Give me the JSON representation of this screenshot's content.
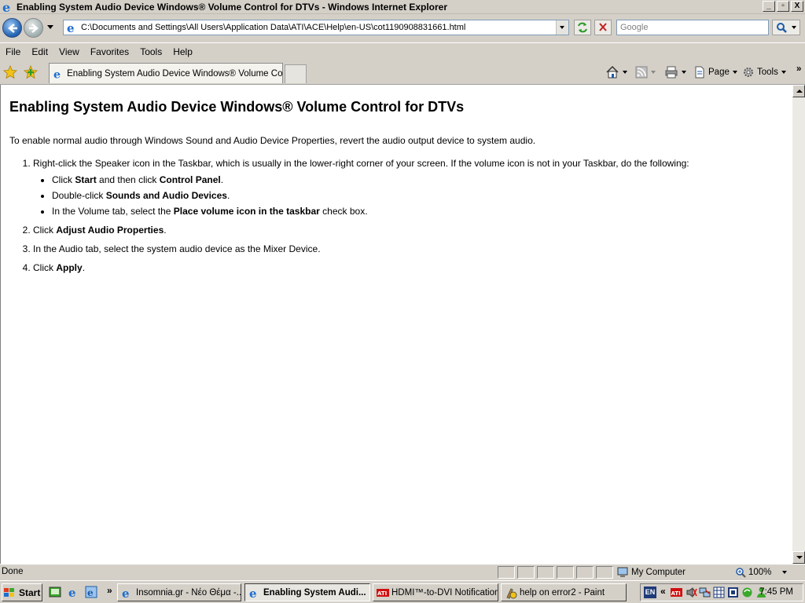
{
  "window": {
    "title": "Enabling System Audio Device Windows® Volume Control for DTVs - Windows Internet Explorer",
    "controls": [
      "_",
      "▫",
      "X"
    ]
  },
  "address_bar": {
    "url": "C:\\Documents and Settings\\All Users\\Application Data\\ATI\\ACE\\Help\\en-US\\cot1190908831661.html"
  },
  "search": {
    "placeholder": "Google"
  },
  "menu": [
    "File",
    "Edit",
    "View",
    "Favorites",
    "Tools",
    "Help"
  ],
  "tabs": [
    {
      "label": "Enabling System Audio Device Windows® Volume Con..."
    }
  ],
  "command_bar": {
    "page_label": "Page",
    "tools_label": "Tools",
    "overflow": "»"
  },
  "document": {
    "heading": "Enabling System Audio Device Windows® Volume Control for DTVs",
    "intro": "To enable normal audio through Windows Sound and Audio Device Properties, revert the audio output device to system audio.",
    "steps": [
      {
        "parts": [
          "Right-click the Speaker icon in the Taskbar, which is usually in the lower-right corner of your screen. If the volume icon is not in your Taskbar, do the following:"
        ],
        "substeps": [
          [
            "Click ",
            "Start",
            " and then click ",
            "Control Panel",
            "."
          ],
          [
            "Double-click ",
            "Sounds and Audio Devices",
            "."
          ],
          [
            "In the Volume tab, select the ",
            "Place volume icon in the taskbar",
            " check box."
          ]
        ]
      },
      {
        "parts": [
          "Click ",
          "Adjust Audio Properties",
          "."
        ]
      },
      {
        "parts": [
          "In the Audio tab, select the system audio device as the Mixer Device."
        ]
      },
      {
        "parts": [
          "Click ",
          "Apply",
          "."
        ]
      }
    ]
  },
  "status_bar": {
    "text": "Done",
    "zone": "My Computer",
    "zoom": "100%"
  },
  "taskbar": {
    "start_label": "Start",
    "chevron": "»",
    "tasks": [
      {
        "label": "Insomnia.gr - Νέο Θέμα -...",
        "active": false
      },
      {
        "label": "Enabling System Audi...",
        "active": true
      },
      {
        "label": "HDMI™-to-DVI Notification",
        "active": false
      },
      {
        "label": "help on error2 - Paint",
        "active": false
      }
    ],
    "tray": {
      "lang": "EN",
      "chevron": "«",
      "clock": "7:45 PM"
    }
  },
  "colors": {
    "ie_blue": "#1e5aa8",
    "chrome": "#d4d0c8",
    "ati_red": "#d01010"
  }
}
